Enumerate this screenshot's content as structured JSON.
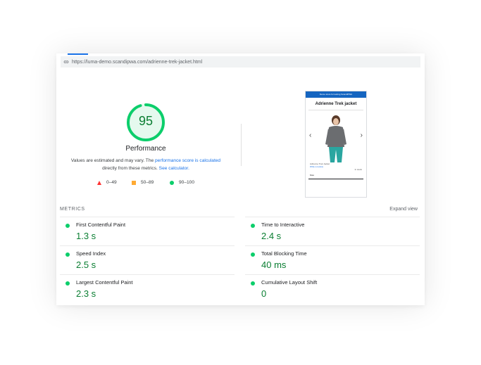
{
  "url": "https://luma-demo.scandipwa.com/adrienne-trek-jacket.html",
  "gauge": {
    "score": "95",
    "score_fraction": 0.95,
    "label": "Performance"
  },
  "description": {
    "part1": "Values are estimated and may vary. The ",
    "link1": "performance score is calculated",
    "part2": " directly from these metrics. ",
    "link2": "See calculator."
  },
  "legend": {
    "fail": "0–49",
    "average": "50–89",
    "pass": "90–100"
  },
  "screenshot": {
    "banner": "Demo store for testing ScandiPWA",
    "product_title": "Adrienne Trek jacket",
    "product_name": "Adrienne Trek Jacket",
    "write_review": "Write a review",
    "in_stock": "In stock",
    "size_label": "Size"
  },
  "metrics": {
    "title": "METRICS",
    "expand": "Expand view",
    "items": [
      {
        "name": "First Contentful Paint",
        "value": "1.3 s"
      },
      {
        "name": "Time to Interactive",
        "value": "2.4 s"
      },
      {
        "name": "Speed Index",
        "value": "2.5 s"
      },
      {
        "name": "Total Blocking Time",
        "value": "40 ms"
      },
      {
        "name": "Largest Contentful Paint",
        "value": "2.3 s"
      },
      {
        "name": "Cumulative Layout Shift",
        "value": "0"
      }
    ]
  },
  "colors": {
    "pass": "#0cce6b",
    "pass_text": "#0a7e32",
    "average": "#ffaa33",
    "fail": "#ff3333",
    "link": "#1a73e8"
  }
}
